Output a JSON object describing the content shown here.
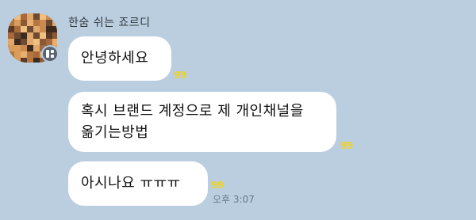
{
  "sender": {
    "name": "한숨 쉬는 죠르디",
    "avatar_icon": "blurred-profile-photo"
  },
  "messages": [
    {
      "lines": [
        "안녕하세요"
      ],
      "read_marker": "99"
    },
    {
      "lines": [
        "혹시 브랜드 계정으로 제 개인채널을",
        "옮기는방법"
      ],
      "read_marker": "99"
    },
    {
      "lines": [
        "아시나요 ㅠㅠㅠ"
      ],
      "read_marker": "99",
      "time": "오후 3:07"
    }
  ],
  "colors": {
    "background": "#bacee0",
    "bubble": "#ffffff",
    "read_marker": "#f1d21f"
  }
}
